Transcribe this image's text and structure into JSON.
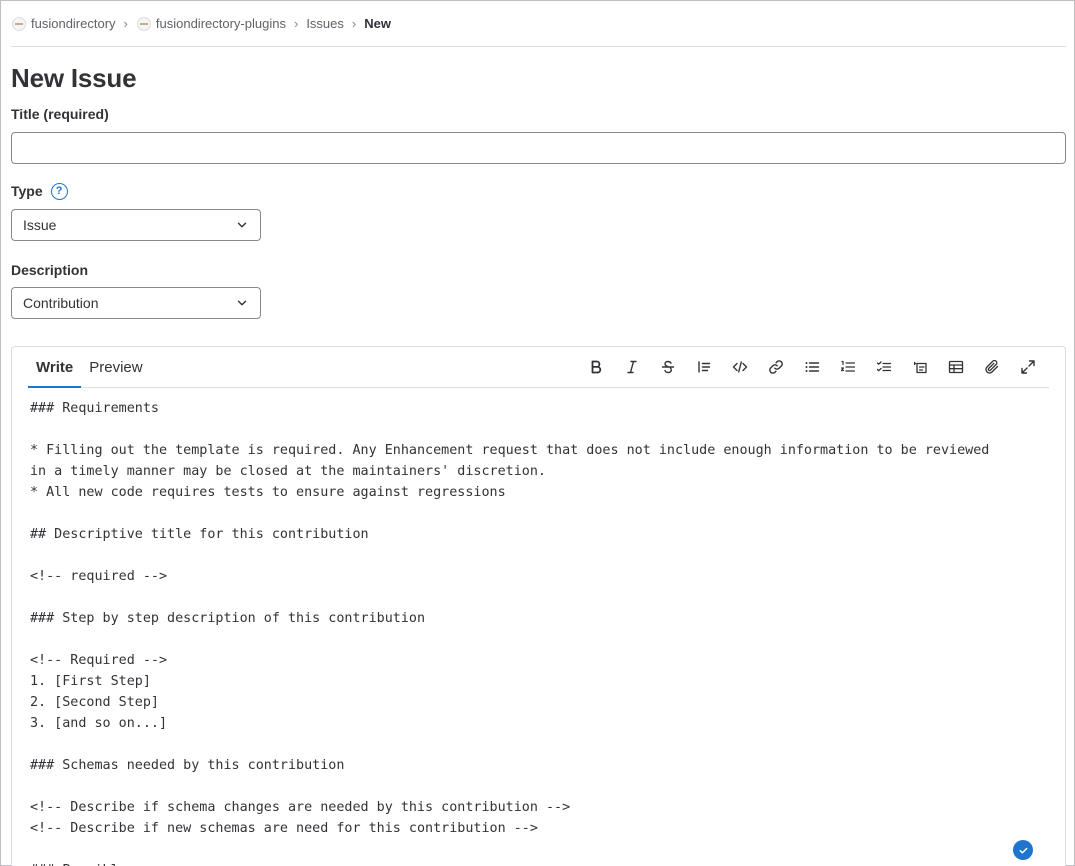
{
  "breadcrumb": {
    "items": [
      {
        "label": "fusiondirectory",
        "has_avatar": true
      },
      {
        "label": "fusiondirectory-plugins",
        "has_avatar": true
      },
      {
        "label": "Issues",
        "has_avatar": false
      }
    ],
    "current": "New",
    "separator": "›"
  },
  "page_title": "New Issue",
  "form": {
    "title_label": "Title (required)",
    "title_value": "",
    "type_label": "Type",
    "type_help_icon": "question-circle-icon",
    "type_value": "Issue",
    "description_label": "Description",
    "template_value": "Contribution"
  },
  "editor": {
    "tabs": [
      {
        "label": "Write",
        "active": true
      },
      {
        "label": "Preview",
        "active": false
      }
    ],
    "toolbar": [
      "bold-icon",
      "italic-icon",
      "strikethrough-icon",
      "quote-icon",
      "code-icon",
      "link-icon",
      "bullet-list-icon",
      "numbered-list-icon",
      "task-list-icon",
      "collapsible-section-icon",
      "table-icon",
      "attach-file-icon",
      "fullscreen-icon"
    ],
    "lines": [
      "### Requirements",
      "",
      "* Filling out the template is required. Any Enhancement request that does not include enough information to be reviewed",
      "in a timely manner may be closed at the maintainers' discretion.",
      "* All new code requires tests to ensure against regressions",
      "",
      "## Descriptive title for this contribution",
      "",
      "<!-- required -->",
      "",
      "### Step by step description of this contribution",
      "",
      "<!-- Required -->",
      "1. [First Step]",
      "2. [Second Step]",
      "3. [and so on...]",
      "",
      "### Schemas needed by this contribution",
      "",
      "<!-- Describe if schema changes are needed by this contribution -->",
      "<!-- Describe if new schemas are need for this contribution -->",
      "",
      "### Possible"
    ]
  },
  "colors": {
    "accent": "#1f75cb",
    "text": "#333238",
    "border": "#89888d"
  }
}
